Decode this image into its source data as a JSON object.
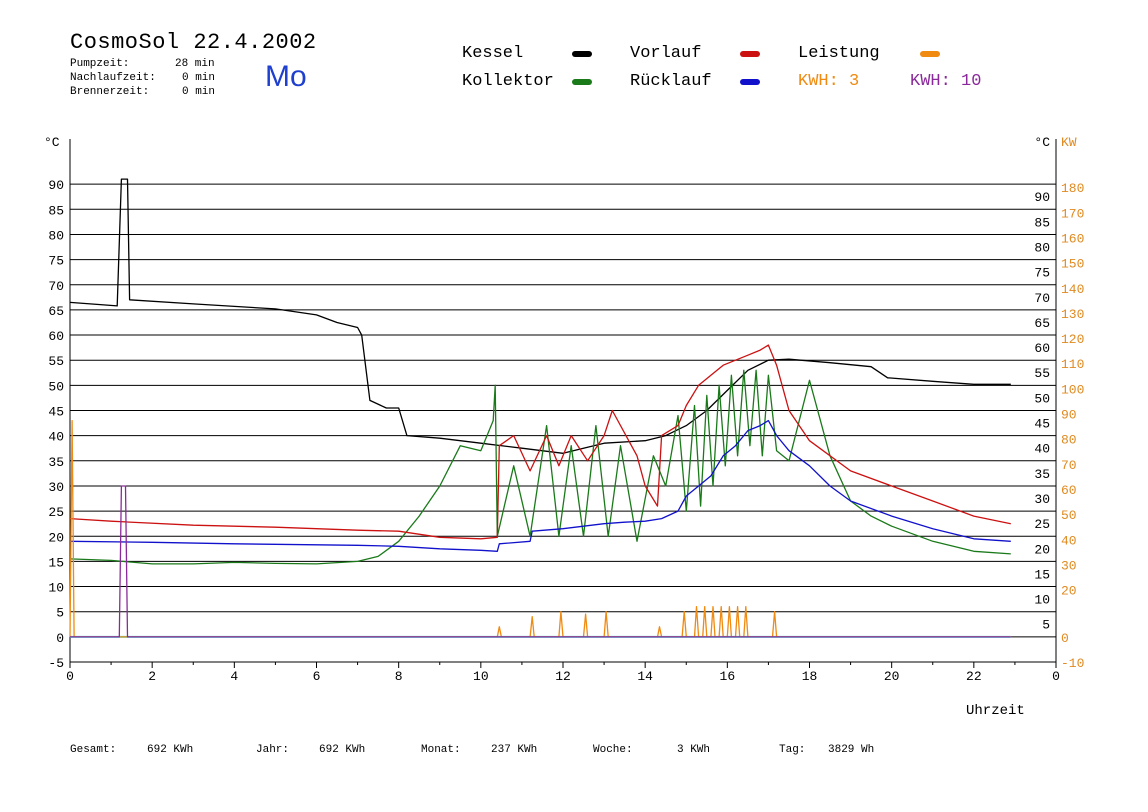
{
  "header": {
    "title": "CosmoSol 22.4.2002",
    "pumpzeit_label": "Pumpzeit:",
    "pumpzeit_value": "28 min",
    "nachlauf_label": "Nachlaufzeit:",
    "nachlauf_value": "0 min",
    "brenner_label": "Brennerzeit:",
    "brenner_value": "0 min",
    "day": "Mo"
  },
  "legend": {
    "kessel": "Kessel",
    "kollektor": "Kollektor",
    "vorlauf": "Vorlauf",
    "ruecklauf": "Rücklauf",
    "leistung": "Leistung",
    "kwh_orange": "KWH: 3",
    "kwh_purple": "KWH: 10"
  },
  "footer": {
    "gesamt_label": "Gesamt:",
    "gesamt_value": "692 KWh",
    "jahr_label": "Jahr:",
    "jahr_value": "692 KWh",
    "monat_label": "Monat:",
    "monat_value": "237 KWh",
    "woche_label": "Woche:",
    "woche_value": "3 KWh",
    "tag_label": "Tag:",
    "tag_value": "3829 Wh"
  },
  "colors": {
    "kessel": "#000000",
    "kollektor": "#1a7a1a",
    "vorlauf": "#cc1111",
    "ruecklauf": "#1111cc",
    "leistung": "#f08a10",
    "purple": "#8a2a9a",
    "baseline": "#40e0e0",
    "kw_axis": "#e08a20"
  },
  "chart_data": {
    "type": "line",
    "xlabel": "Uhrzeit",
    "ylabel_left": "°C",
    "ylabel_right": "KW",
    "xlim": [
      0,
      24
    ],
    "ylim": [
      -5,
      95
    ],
    "x_ticks": [
      0,
      2,
      4,
      6,
      8,
      10,
      12,
      14,
      16,
      18,
      20,
      22,
      0
    ],
    "y_ticks_left": [
      90,
      85,
      80,
      75,
      70,
      65,
      60,
      55,
      50,
      45,
      40,
      35,
      30,
      25,
      20,
      15,
      10,
      5,
      0,
      -5
    ],
    "y_ticks_right_c": [
      90,
      85,
      80,
      75,
      70,
      65,
      60,
      55,
      50,
      45,
      40,
      35,
      30,
      25,
      20,
      15,
      10,
      5
    ],
    "y_ticks_right_kw": [
      180,
      170,
      160,
      150,
      140,
      130,
      120,
      110,
      100,
      90,
      80,
      70,
      60,
      50,
      40,
      30,
      20,
      0,
      -10
    ],
    "grid": "horizontal",
    "series": [
      {
        "name": "Kessel",
        "color_key": "kessel",
        "points": [
          [
            0,
            66.5
          ],
          [
            1.15,
            65.8
          ],
          [
            1.25,
            91
          ],
          [
            1.4,
            91
          ],
          [
            1.45,
            67
          ],
          [
            3,
            66.2
          ],
          [
            5,
            65.2
          ],
          [
            6,
            64
          ],
          [
            6.5,
            62.5
          ],
          [
            7,
            61.5
          ],
          [
            7.1,
            60
          ],
          [
            7.3,
            47
          ],
          [
            7.7,
            45.5
          ],
          [
            8,
            45.5
          ],
          [
            8.2,
            40
          ],
          [
            9,
            39.5
          ],
          [
            10,
            38.5
          ],
          [
            11,
            37.5
          ],
          [
            12,
            36.5
          ],
          [
            12.5,
            37.5
          ],
          [
            13,
            38.5
          ],
          [
            14,
            39
          ],
          [
            14.5,
            40
          ],
          [
            15,
            42
          ],
          [
            15.5,
            45
          ],
          [
            16,
            49
          ],
          [
            16.5,
            53
          ],
          [
            17,
            55
          ],
          [
            17.5,
            55.2
          ],
          [
            18.5,
            54.5
          ],
          [
            19.5,
            53.7
          ],
          [
            19.9,
            51.5
          ],
          [
            21,
            50.8
          ],
          [
            22,
            50.2
          ],
          [
            22.9,
            50.2
          ]
        ]
      },
      {
        "name": "Kollektor",
        "color_key": "kollektor",
        "points": [
          [
            0,
            15.5
          ],
          [
            1,
            15.2
          ],
          [
            2,
            14.5
          ],
          [
            3,
            14.5
          ],
          [
            4,
            14.8
          ],
          [
            5,
            14.6
          ],
          [
            6,
            14.5
          ],
          [
            7,
            15
          ],
          [
            7.5,
            16
          ],
          [
            8,
            19
          ],
          [
            8.5,
            24
          ],
          [
            9,
            30
          ],
          [
            9.5,
            38
          ],
          [
            10,
            37
          ],
          [
            10.3,
            43
          ],
          [
            10.35,
            50
          ],
          [
            10.4,
            20
          ],
          [
            10.8,
            34
          ],
          [
            11.2,
            20
          ],
          [
            11.6,
            42
          ],
          [
            11.9,
            20
          ],
          [
            12.2,
            38
          ],
          [
            12.5,
            20
          ],
          [
            12.8,
            42
          ],
          [
            13.1,
            20
          ],
          [
            13.4,
            38
          ],
          [
            13.8,
            19
          ],
          [
            14.2,
            36
          ],
          [
            14.5,
            30
          ],
          [
            14.8,
            44
          ],
          [
            15,
            25
          ],
          [
            15.2,
            46
          ],
          [
            15.35,
            26
          ],
          [
            15.5,
            48
          ],
          [
            15.65,
            30
          ],
          [
            15.8,
            50
          ],
          [
            15.95,
            34
          ],
          [
            16.1,
            52
          ],
          [
            16.25,
            36
          ],
          [
            16.4,
            53
          ],
          [
            16.55,
            38
          ],
          [
            16.7,
            53
          ],
          [
            16.85,
            36
          ],
          [
            17,
            52
          ],
          [
            17.2,
            37
          ],
          [
            17.5,
            35
          ],
          [
            18,
            51
          ],
          [
            18.5,
            36
          ],
          [
            19,
            27
          ],
          [
            19.5,
            24
          ],
          [
            20,
            22
          ],
          [
            21,
            19
          ],
          [
            22,
            17
          ],
          [
            22.9,
            16.5
          ]
        ]
      },
      {
        "name": "Vorlauf",
        "color_key": "vorlauf",
        "points": [
          [
            0,
            23.5
          ],
          [
            1,
            23
          ],
          [
            3,
            22.2
          ],
          [
            5,
            21.8
          ],
          [
            7,
            21.2
          ],
          [
            8,
            21
          ],
          [
            9,
            19.8
          ],
          [
            10,
            19.5
          ],
          [
            10.4,
            19.8
          ],
          [
            10.45,
            38
          ],
          [
            10.8,
            40
          ],
          [
            11.2,
            33
          ],
          [
            11.6,
            40
          ],
          [
            11.9,
            34
          ],
          [
            12.2,
            40
          ],
          [
            12.6,
            35
          ],
          [
            13,
            40
          ],
          [
            13.2,
            45
          ],
          [
            13.8,
            36
          ],
          [
            14,
            30
          ],
          [
            14.3,
            26
          ],
          [
            14.4,
            40
          ],
          [
            14.8,
            42
          ],
          [
            15,
            46
          ],
          [
            15.3,
            50
          ],
          [
            15.6,
            52
          ],
          [
            15.9,
            54
          ],
          [
            16.2,
            55
          ],
          [
            16.5,
            56
          ],
          [
            16.8,
            57
          ],
          [
            17,
            58
          ],
          [
            17.2,
            54
          ],
          [
            17.5,
            45
          ],
          [
            18,
            39
          ],
          [
            19,
            33
          ],
          [
            20,
            30
          ],
          [
            21,
            27
          ],
          [
            22,
            24
          ],
          [
            22.9,
            22.5
          ]
        ]
      },
      {
        "name": "Rücklauf",
        "color_key": "ruecklauf",
        "points": [
          [
            0,
            19
          ],
          [
            2,
            18.8
          ],
          [
            4,
            18.5
          ],
          [
            6,
            18.3
          ],
          [
            7,
            18.2
          ],
          [
            8,
            18
          ],
          [
            9,
            17.5
          ],
          [
            10,
            17.2
          ],
          [
            10.4,
            17
          ],
          [
            10.45,
            18.5
          ],
          [
            11.2,
            19
          ],
          [
            11.25,
            21
          ],
          [
            12,
            21.5
          ],
          [
            12.5,
            22
          ],
          [
            13,
            22.5
          ],
          [
            13.5,
            22.8
          ],
          [
            14,
            23
          ],
          [
            14.4,
            23.5
          ],
          [
            14.8,
            25
          ],
          [
            15,
            28
          ],
          [
            15.3,
            30
          ],
          [
            15.6,
            32
          ],
          [
            15.9,
            36
          ],
          [
            16.2,
            38
          ],
          [
            16.5,
            41
          ],
          [
            16.8,
            42
          ],
          [
            17,
            43
          ],
          [
            17.2,
            40
          ],
          [
            17.5,
            37
          ],
          [
            18,
            34
          ],
          [
            18.5,
            30
          ],
          [
            19,
            27
          ],
          [
            20,
            24
          ],
          [
            21,
            21.5
          ],
          [
            22,
            19.5
          ],
          [
            22.9,
            19
          ]
        ]
      },
      {
        "name": "Leistung",
        "color_key": "leistung",
        "points": [
          [
            0,
            0
          ],
          [
            0.05,
            43
          ],
          [
            0.1,
            0
          ],
          [
            10.4,
            0
          ],
          [
            10.45,
            2
          ],
          [
            10.5,
            0
          ],
          [
            11.2,
            0
          ],
          [
            11.25,
            4
          ],
          [
            11.3,
            0
          ],
          [
            11.9,
            0
          ],
          [
            11.95,
            5
          ],
          [
            12,
            0
          ],
          [
            12.5,
            0
          ],
          [
            12.55,
            4.5
          ],
          [
            12.6,
            0
          ],
          [
            13,
            0
          ],
          [
            13.05,
            5
          ],
          [
            13.1,
            0
          ],
          [
            14.3,
            0
          ],
          [
            14.35,
            2
          ],
          [
            14.4,
            0
          ],
          [
            14.9,
            0
          ],
          [
            14.95,
            5
          ],
          [
            15,
            0
          ],
          [
            15.2,
            0
          ],
          [
            15.25,
            6
          ],
          [
            15.3,
            0
          ],
          [
            15.4,
            0
          ],
          [
            15.45,
            6
          ],
          [
            15.5,
            0
          ],
          [
            15.6,
            0
          ],
          [
            15.65,
            6
          ],
          [
            15.7,
            0
          ],
          [
            15.8,
            0
          ],
          [
            15.85,
            6
          ],
          [
            15.9,
            0
          ],
          [
            16,
            0
          ],
          [
            16.05,
            6
          ],
          [
            16.1,
            0
          ],
          [
            16.2,
            0
          ],
          [
            16.25,
            6
          ],
          [
            16.3,
            0
          ],
          [
            16.4,
            0
          ],
          [
            16.45,
            6
          ],
          [
            16.5,
            0
          ],
          [
            17.1,
            0
          ],
          [
            17.15,
            5
          ],
          [
            17.2,
            0
          ],
          [
            22.9,
            0
          ]
        ]
      },
      {
        "name": "KWH purple",
        "color_key": "purple",
        "points": [
          [
            0,
            0
          ],
          [
            1.2,
            0
          ],
          [
            1.25,
            30
          ],
          [
            1.35,
            30
          ],
          [
            1.4,
            0
          ],
          [
            22.9,
            0
          ]
        ]
      }
    ]
  }
}
